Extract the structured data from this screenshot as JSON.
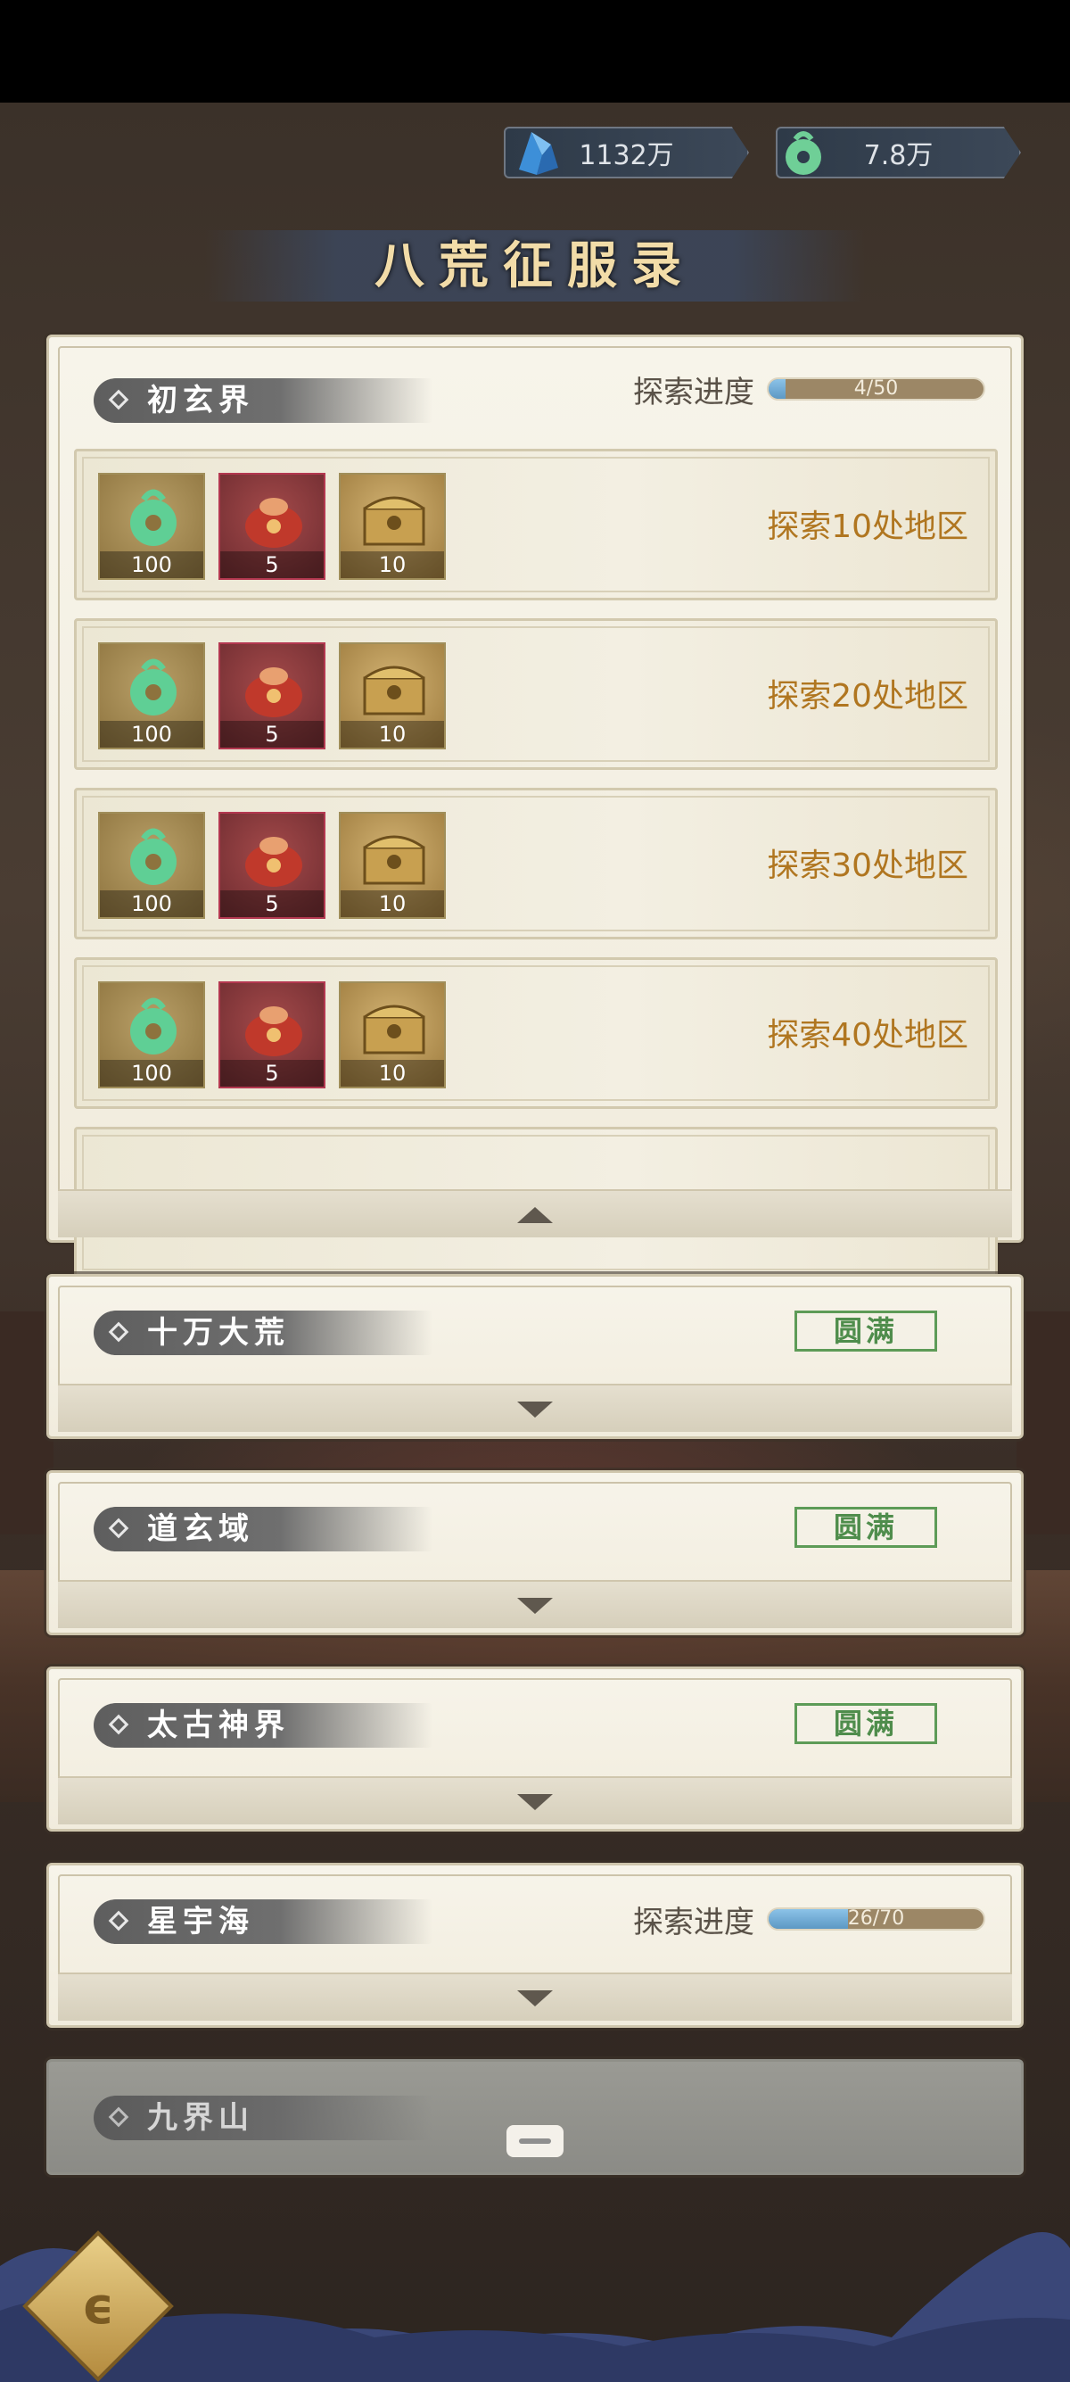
{
  "currencies": [
    {
      "icon": "crystal-icon",
      "value": "1132万"
    },
    {
      "icon": "jade-coin-icon",
      "value": "7.8万"
    }
  ],
  "title": "八荒征服录",
  "progress_label": "探索进度",
  "complete_label": "圆满",
  "realms": [
    {
      "name": "初玄界",
      "status": "progress",
      "progress_text": "4/50",
      "progress_fraction": 0.08,
      "expanded": true,
      "rewards": [
        {
          "goal": "探索10处地区",
          "items": [
            {
              "type": "jade",
              "qty": "100"
            },
            {
              "type": "bag",
              "qty": "5"
            },
            {
              "type": "chest",
              "qty": "10"
            }
          ]
        },
        {
          "goal": "探索20处地区",
          "items": [
            {
              "type": "jade",
              "qty": "100"
            },
            {
              "type": "bag",
              "qty": "5"
            },
            {
              "type": "chest",
              "qty": "10"
            }
          ]
        },
        {
          "goal": "探索30处地区",
          "items": [
            {
              "type": "jade",
              "qty": "100"
            },
            {
              "type": "bag",
              "qty": "5"
            },
            {
              "type": "chest",
              "qty": "10"
            }
          ]
        },
        {
          "goal": "探索40处地区",
          "items": [
            {
              "type": "jade",
              "qty": "100"
            },
            {
              "type": "bag",
              "qty": "5"
            },
            {
              "type": "chest",
              "qty": "10"
            }
          ]
        }
      ]
    },
    {
      "name": "十万大荒",
      "status": "complete",
      "expanded": false
    },
    {
      "name": "道玄域",
      "status": "complete",
      "expanded": false
    },
    {
      "name": "太古神界",
      "status": "complete",
      "expanded": false
    },
    {
      "name": "星宇海",
      "status": "progress",
      "progress_text": "26/70",
      "progress_fraction": 0.371,
      "expanded": false
    },
    {
      "name": "九界山",
      "status": "locked",
      "expanded": false
    }
  ]
}
